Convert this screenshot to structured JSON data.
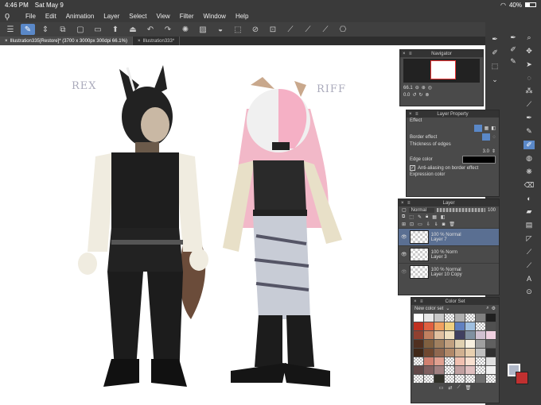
{
  "status": {
    "time": "4:46 PM",
    "date": "Sat May 9",
    "battery": "40%"
  },
  "menu": [
    "File",
    "Edit",
    "Animation",
    "Layer",
    "Select",
    "View",
    "Filter",
    "Window",
    "Help"
  ],
  "tabs": [
    {
      "label": "Illustration335[Restore]* (3700 x 3000px 300dpi 66.1%)"
    },
    {
      "label": "Illustration333*"
    }
  ],
  "canvas": {
    "left_name": "REX",
    "right_name": "RIFF"
  },
  "navigator": {
    "title": "Navigator",
    "zoom": "66.1",
    "angle": "0.0"
  },
  "layer_property": {
    "title": "Layer Property",
    "effect_label": "Effect",
    "border_effect_label": "Border effect",
    "thickness_label": "Thickness of edges",
    "thickness_value": "3.0",
    "edge_color_label": "Edge color",
    "antialias_label": "Anti-aliasing on border effect",
    "expression_label": "Expression color"
  },
  "layer_panel": {
    "title": "Layer",
    "blend_mode": "Normal",
    "opacity": "100",
    "layers": [
      {
        "mode": "100 % Normal",
        "name": "Layer 7",
        "selected": true
      },
      {
        "mode": "100 % Norm",
        "name": "Layer 3",
        "selected": false
      },
      {
        "mode": "100 % Normal",
        "name": "Layer 10 Copy",
        "selected": false
      }
    ]
  },
  "color_set": {
    "title": "Color Set",
    "set_name": "New color set",
    "colors": [
      "#ffffff",
      "#e8e8e8",
      "#c8c8c8",
      "chk",
      "#b0b0b0",
      "chk",
      "#808080",
      "#202020",
      "#c03020",
      "#e06040",
      "#f0a060",
      "#f0d080",
      "#6080c0",
      "#a0c0e0",
      "chk",
      "#505050",
      "#904030",
      "#c08060",
      "#e0c0a0",
      "#f0e0c0",
      "#404060",
      "#8090a0",
      "#d0c0d0",
      "#f0d0e0",
      "#503020",
      "#806040",
      "#a08060",
      "#c0a080",
      "#e0d0b0",
      "#f8f0e0",
      "#a0a0a0",
      "#606060",
      "#402818",
      "#704830",
      "#906850",
      "#b08868",
      "#d0b090",
      "#e8d0b0",
      "#c0c0c0",
      "#303030",
      "chk",
      "#d08070",
      "#e0a090",
      "chk",
      "#f0c0b0",
      "#f8e0d0",
      "chk",
      "#e0e0e0",
      "#604848",
      "#806060",
      "#a08080",
      "chk",
      "#c0a0a0",
      "#e0c0c0",
      "chk",
      "#f0f0f0",
      "chk",
      "chk",
      "#303028",
      "chk",
      "chk",
      "chk",
      "#707070",
      "chk"
    ]
  },
  "colors": {
    "main": "#b0b8c8",
    "sub": "#c03030",
    "accent": "#5a88c8"
  }
}
